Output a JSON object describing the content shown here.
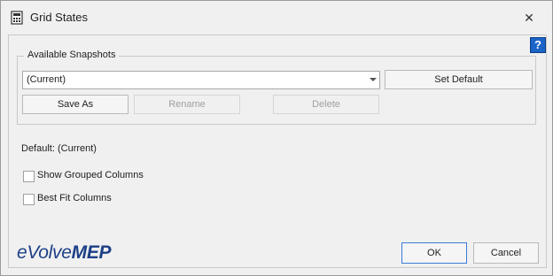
{
  "window": {
    "title": "Grid States",
    "close_label": "✕"
  },
  "help": {
    "label": "?"
  },
  "snapshots": {
    "group_label": "Available Snapshots",
    "selected_value": "(Current)",
    "set_default_label": "Set Default",
    "save_as_label": "Save As",
    "rename_label": "Rename",
    "delete_label": "Delete"
  },
  "default_text": "Default: (Current)",
  "options": {
    "show_grouped_columns": {
      "label": "Show Grouped Columns",
      "checked": false
    },
    "best_fit_columns": {
      "label": "Best Fit Columns",
      "checked": false
    }
  },
  "brand": {
    "logo_text_e": "eVolve",
    "logo_text_mep": "MEP",
    "color": "#1d3f86"
  },
  "footer": {
    "ok_label": "OK",
    "cancel_label": "Cancel"
  },
  "colors": {
    "accent": "#3b7bd6",
    "help_icon_bg": "#1b64c8"
  }
}
